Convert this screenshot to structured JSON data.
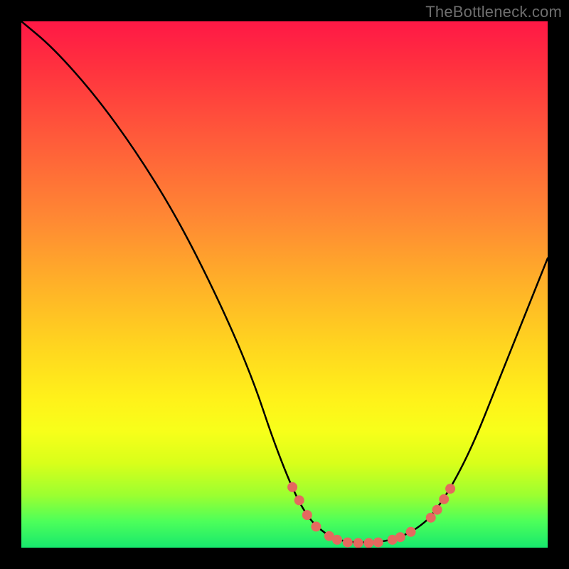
{
  "watermark": "TheBottleneck.com",
  "chart_data": {
    "type": "line",
    "title": "",
    "xlabel": "",
    "ylabel": "",
    "xlim": [
      0,
      100
    ],
    "ylim": [
      0,
      100
    ],
    "curve": {
      "name": "bottleneck-curve",
      "points": [
        {
          "x": 0,
          "y": 100
        },
        {
          "x": 6,
          "y": 95
        },
        {
          "x": 14,
          "y": 86
        },
        {
          "x": 22,
          "y": 75
        },
        {
          "x": 30,
          "y": 62
        },
        {
          "x": 38,
          "y": 46
        },
        {
          "x": 44,
          "y": 32
        },
        {
          "x": 48,
          "y": 20
        },
        {
          "x": 52,
          "y": 10
        },
        {
          "x": 55,
          "y": 5
        },
        {
          "x": 58,
          "y": 2.5
        },
        {
          "x": 60,
          "y": 1.5
        },
        {
          "x": 63,
          "y": 1
        },
        {
          "x": 66,
          "y": 1
        },
        {
          "x": 69,
          "y": 1.2
        },
        {
          "x": 72,
          "y": 2
        },
        {
          "x": 75,
          "y": 3.5
        },
        {
          "x": 78,
          "y": 6
        },
        {
          "x": 82,
          "y": 12
        },
        {
          "x": 86,
          "y": 20
        },
        {
          "x": 90,
          "y": 30
        },
        {
          "x": 94,
          "y": 40
        },
        {
          "x": 98,
          "y": 50
        },
        {
          "x": 100,
          "y": 55
        }
      ]
    },
    "highlight_dots": {
      "name": "optimal-range-markers",
      "color": "#e5695f",
      "radius": 7,
      "points": [
        {
          "x": 51.5,
          "y": 11.5
        },
        {
          "x": 52.8,
          "y": 9.0
        },
        {
          "x": 54.3,
          "y": 6.2
        },
        {
          "x": 56.0,
          "y": 4.0
        },
        {
          "x": 58.5,
          "y": 2.2
        },
        {
          "x": 60.0,
          "y": 1.5
        },
        {
          "x": 62.0,
          "y": 1.0
        },
        {
          "x": 64.0,
          "y": 0.9
        },
        {
          "x": 66.0,
          "y": 0.9
        },
        {
          "x": 67.8,
          "y": 1.0
        },
        {
          "x": 70.5,
          "y": 1.5
        },
        {
          "x": 72.0,
          "y": 2.0
        },
        {
          "x": 74.0,
          "y": 3.0
        },
        {
          "x": 77.8,
          "y": 5.7
        },
        {
          "x": 79.0,
          "y": 7.2
        },
        {
          "x": 80.3,
          "y": 9.2
        },
        {
          "x": 81.5,
          "y": 11.2
        }
      ]
    }
  }
}
